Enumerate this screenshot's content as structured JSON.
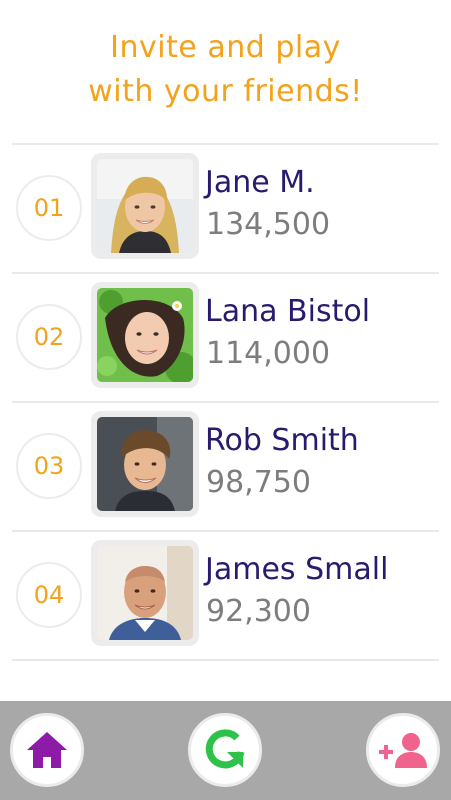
{
  "header": {
    "title_line1": "Invite and play",
    "title_line2": "with your friends!"
  },
  "leaderboard": [
    {
      "rank": "01",
      "name": "Jane M.",
      "score": "134,500"
    },
    {
      "rank": "02",
      "name": "Lana Bistol",
      "score": "114,000"
    },
    {
      "rank": "03",
      "name": "Rob Smith",
      "score": "98,750"
    },
    {
      "rank": "04",
      "name": "James Small",
      "score": "92,300"
    }
  ],
  "bottom_nav": {
    "home_icon": "home-icon",
    "refresh_icon": "refresh-icon",
    "add_friend_icon": "add-friend-icon"
  },
  "colors": {
    "accent_orange": "#f3a21b",
    "name_navy": "#2a1a6e",
    "score_gray": "#7d7d7d",
    "home_purple": "#8e1aa8",
    "refresh_green": "#2ec24a",
    "invite_pink": "#f0638c",
    "bar_gray": "#a8a8a8"
  }
}
